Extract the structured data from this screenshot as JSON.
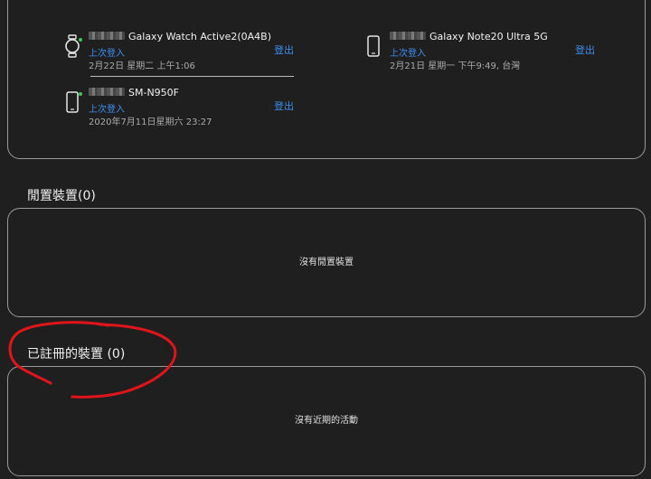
{
  "devices": [
    {
      "name": "Galaxy Watch Active2(0A4B)",
      "label": "上次登入",
      "time": "2月22日 星期二 上午1:06",
      "logout": "登出",
      "icon": "smartwatch-icon"
    },
    {
      "name": "Galaxy Note20 Ultra 5G",
      "label": "上次登入",
      "time": "2月21日 星期一 下午9:49, 台灣",
      "logout": "登出",
      "icon": "smartphone-icon"
    },
    {
      "name": "SM-N950F",
      "label": "上次登入",
      "time": "2020年7月11日星期六 23:27",
      "logout": "登出",
      "icon": "smartphone-icon"
    }
  ],
  "idle_section": {
    "title": "閒置裝置(0)",
    "empty": "沒有閒置裝置"
  },
  "registered_section": {
    "title": "已註冊的裝置 (0)",
    "empty": "沒有近期的活動"
  },
  "colors": {
    "background": "#1f1f1f",
    "link": "#3e8ef0",
    "online": "#3cc45a",
    "annotation": "#e0151b"
  }
}
